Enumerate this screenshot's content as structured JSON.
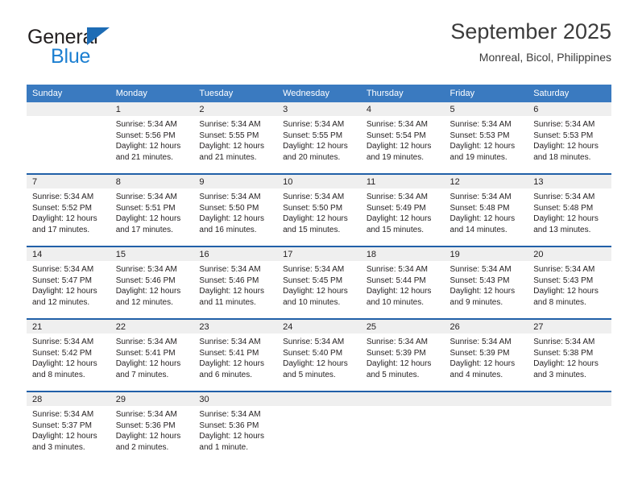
{
  "logo": {
    "word_top": "General",
    "word_bottom": "Blue",
    "triangle_color": "#1d6cb5",
    "blue_color": "#1c7fd1"
  },
  "header": {
    "title": "September 2025",
    "subtitle": "Monreal, Bicol, Philippines"
  },
  "theme": {
    "header_row_bg": "#3a7ac0",
    "week_separator": "#2160a8",
    "daynum_band_bg": "#efefef",
    "text": "#231f20"
  },
  "weekdays": [
    "Sunday",
    "Monday",
    "Tuesday",
    "Wednesday",
    "Thursday",
    "Friday",
    "Saturday"
  ],
  "weeks": [
    [
      {
        "day": "",
        "empty": true
      },
      {
        "day": "1",
        "sunrise": "Sunrise: 5:34 AM",
        "sunset": "Sunset: 5:56 PM",
        "daylight": "Daylight: 12 hours and 21 minutes."
      },
      {
        "day": "2",
        "sunrise": "Sunrise: 5:34 AM",
        "sunset": "Sunset: 5:55 PM",
        "daylight": "Daylight: 12 hours and 21 minutes."
      },
      {
        "day": "3",
        "sunrise": "Sunrise: 5:34 AM",
        "sunset": "Sunset: 5:55 PM",
        "daylight": "Daylight: 12 hours and 20 minutes."
      },
      {
        "day": "4",
        "sunrise": "Sunrise: 5:34 AM",
        "sunset": "Sunset: 5:54 PM",
        "daylight": "Daylight: 12 hours and 19 minutes."
      },
      {
        "day": "5",
        "sunrise": "Sunrise: 5:34 AM",
        "sunset": "Sunset: 5:53 PM",
        "daylight": "Daylight: 12 hours and 19 minutes."
      },
      {
        "day": "6",
        "sunrise": "Sunrise: 5:34 AM",
        "sunset": "Sunset: 5:53 PM",
        "daylight": "Daylight: 12 hours and 18 minutes."
      }
    ],
    [
      {
        "day": "7",
        "sunrise": "Sunrise: 5:34 AM",
        "sunset": "Sunset: 5:52 PM",
        "daylight": "Daylight: 12 hours and 17 minutes."
      },
      {
        "day": "8",
        "sunrise": "Sunrise: 5:34 AM",
        "sunset": "Sunset: 5:51 PM",
        "daylight": "Daylight: 12 hours and 17 minutes."
      },
      {
        "day": "9",
        "sunrise": "Sunrise: 5:34 AM",
        "sunset": "Sunset: 5:50 PM",
        "daylight": "Daylight: 12 hours and 16 minutes."
      },
      {
        "day": "10",
        "sunrise": "Sunrise: 5:34 AM",
        "sunset": "Sunset: 5:50 PM",
        "daylight": "Daylight: 12 hours and 15 minutes."
      },
      {
        "day": "11",
        "sunrise": "Sunrise: 5:34 AM",
        "sunset": "Sunset: 5:49 PM",
        "daylight": "Daylight: 12 hours and 15 minutes."
      },
      {
        "day": "12",
        "sunrise": "Sunrise: 5:34 AM",
        "sunset": "Sunset: 5:48 PM",
        "daylight": "Daylight: 12 hours and 14 minutes."
      },
      {
        "day": "13",
        "sunrise": "Sunrise: 5:34 AM",
        "sunset": "Sunset: 5:48 PM",
        "daylight": "Daylight: 12 hours and 13 minutes."
      }
    ],
    [
      {
        "day": "14",
        "sunrise": "Sunrise: 5:34 AM",
        "sunset": "Sunset: 5:47 PM",
        "daylight": "Daylight: 12 hours and 12 minutes."
      },
      {
        "day": "15",
        "sunrise": "Sunrise: 5:34 AM",
        "sunset": "Sunset: 5:46 PM",
        "daylight": "Daylight: 12 hours and 12 minutes."
      },
      {
        "day": "16",
        "sunrise": "Sunrise: 5:34 AM",
        "sunset": "Sunset: 5:46 PM",
        "daylight": "Daylight: 12 hours and 11 minutes."
      },
      {
        "day": "17",
        "sunrise": "Sunrise: 5:34 AM",
        "sunset": "Sunset: 5:45 PM",
        "daylight": "Daylight: 12 hours and 10 minutes."
      },
      {
        "day": "18",
        "sunrise": "Sunrise: 5:34 AM",
        "sunset": "Sunset: 5:44 PM",
        "daylight": "Daylight: 12 hours and 10 minutes."
      },
      {
        "day": "19",
        "sunrise": "Sunrise: 5:34 AM",
        "sunset": "Sunset: 5:43 PM",
        "daylight": "Daylight: 12 hours and 9 minutes."
      },
      {
        "day": "20",
        "sunrise": "Sunrise: 5:34 AM",
        "sunset": "Sunset: 5:43 PM",
        "daylight": "Daylight: 12 hours and 8 minutes."
      }
    ],
    [
      {
        "day": "21",
        "sunrise": "Sunrise: 5:34 AM",
        "sunset": "Sunset: 5:42 PM",
        "daylight": "Daylight: 12 hours and 8 minutes."
      },
      {
        "day": "22",
        "sunrise": "Sunrise: 5:34 AM",
        "sunset": "Sunset: 5:41 PM",
        "daylight": "Daylight: 12 hours and 7 minutes."
      },
      {
        "day": "23",
        "sunrise": "Sunrise: 5:34 AM",
        "sunset": "Sunset: 5:41 PM",
        "daylight": "Daylight: 12 hours and 6 minutes."
      },
      {
        "day": "24",
        "sunrise": "Sunrise: 5:34 AM",
        "sunset": "Sunset: 5:40 PM",
        "daylight": "Daylight: 12 hours and 5 minutes."
      },
      {
        "day": "25",
        "sunrise": "Sunrise: 5:34 AM",
        "sunset": "Sunset: 5:39 PM",
        "daylight": "Daylight: 12 hours and 5 minutes."
      },
      {
        "day": "26",
        "sunrise": "Sunrise: 5:34 AM",
        "sunset": "Sunset: 5:39 PM",
        "daylight": "Daylight: 12 hours and 4 minutes."
      },
      {
        "day": "27",
        "sunrise": "Sunrise: 5:34 AM",
        "sunset": "Sunset: 5:38 PM",
        "daylight": "Daylight: 12 hours and 3 minutes."
      }
    ],
    [
      {
        "day": "28",
        "sunrise": "Sunrise: 5:34 AM",
        "sunset": "Sunset: 5:37 PM",
        "daylight": "Daylight: 12 hours and 3 minutes."
      },
      {
        "day": "29",
        "sunrise": "Sunrise: 5:34 AM",
        "sunset": "Sunset: 5:36 PM",
        "daylight": "Daylight: 12 hours and 2 minutes."
      },
      {
        "day": "30",
        "sunrise": "Sunrise: 5:34 AM",
        "sunset": "Sunset: 5:36 PM",
        "daylight": "Daylight: 12 hours and 1 minute."
      },
      {
        "day": "",
        "empty": true
      },
      {
        "day": "",
        "empty": true
      },
      {
        "day": "",
        "empty": true
      },
      {
        "day": "",
        "empty": true
      }
    ]
  ]
}
